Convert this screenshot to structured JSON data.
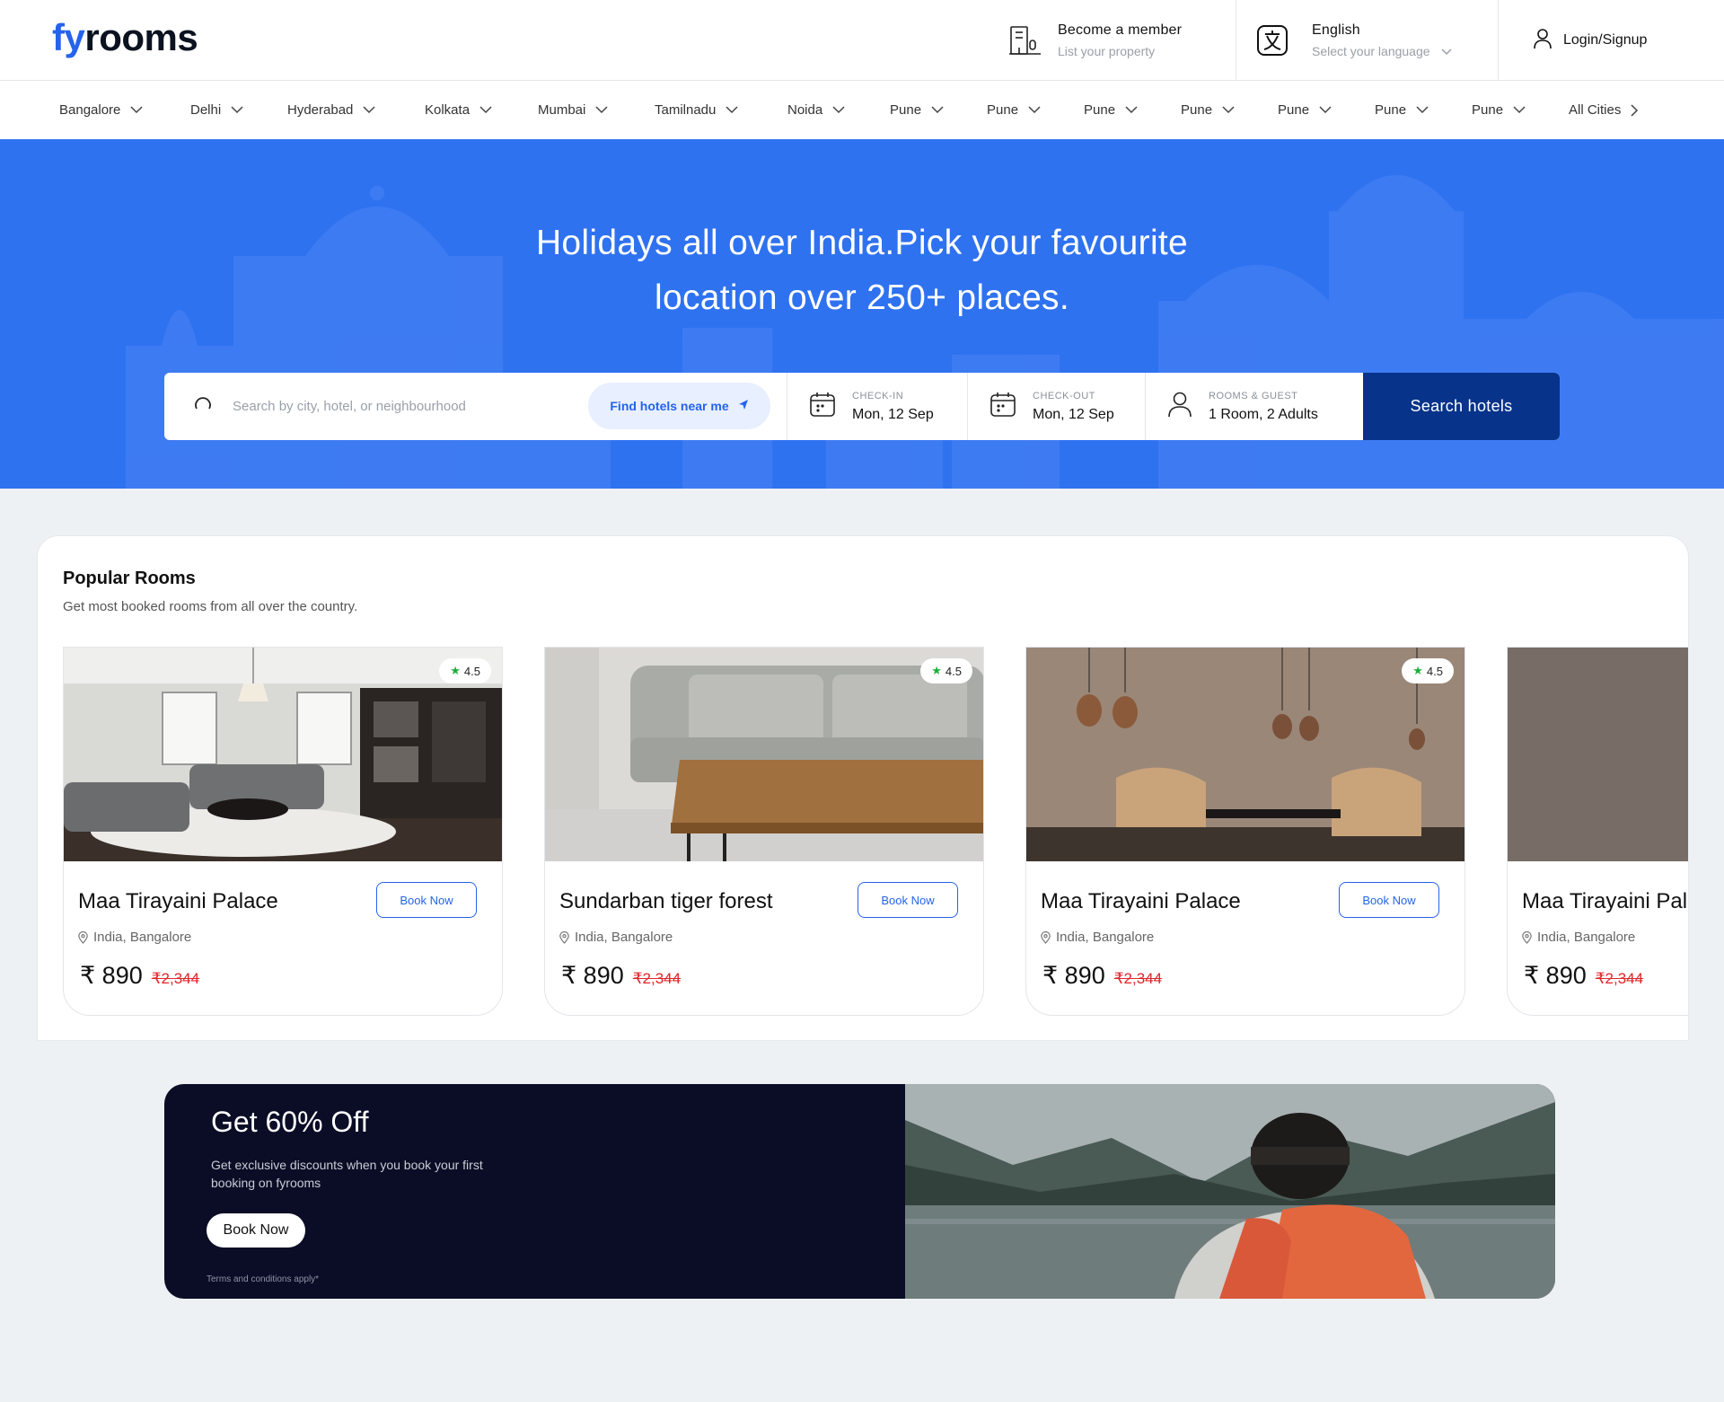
{
  "brand": {
    "part1": "fy",
    "part2": "rooms",
    "accent": "#2563eb"
  },
  "header": {
    "member_title": "Become a member",
    "member_sub": "List your property",
    "language_title": "English",
    "language_sub": "Select your language",
    "login": "Login/Signup"
  },
  "cities": [
    "Bangalore",
    "Delhi",
    "Hyderabad",
    "Kolkata",
    "Mumbai",
    "Tamilnadu",
    "Noida",
    "Pune",
    "Pune",
    "Pune",
    "Pune",
    "Pune",
    "Pune",
    "Pune",
    "All Cities"
  ],
  "hero": {
    "title_line1": "Holidays all over India.Pick your favourite",
    "title_line2": "location over 250+ places.",
    "color": "#2f72f0"
  },
  "search": {
    "placeholder": "Search by city, hotel, or neighbourhood",
    "near_me": "Find hotels near me",
    "checkin_label": "CHECK-IN",
    "checkin_value": "Mon, 12 Sep",
    "checkout_label": "CHECK-OUT",
    "checkout_value": "Mon, 12 Sep",
    "rooms_label": "ROOMS & GUEST",
    "rooms_value": "1 Room, 2 Adults",
    "button": "Search hotels",
    "button_color": "#07338a"
  },
  "popular": {
    "title": "Popular Rooms",
    "subtitle": "Get most booked rooms from all over the country.",
    "cards": [
      {
        "rating": "4.5",
        "name": "Maa Tirayaini Palace",
        "location": "India, Bangalore",
        "price": "₹ 890",
        "old_price": "₹2,344",
        "book": "Book Now"
      },
      {
        "rating": "4.5",
        "name": "Sundarban tiger forest",
        "location": "India, Bangalore",
        "price": "₹ 890",
        "old_price": "₹2,344",
        "book": "Book Now"
      },
      {
        "rating": "4.5",
        "name": "Maa Tirayaini Palace",
        "location": "India, Bangalore",
        "price": "₹ 890",
        "old_price": "₹2,344",
        "book": "Book Now"
      },
      {
        "rating": "",
        "name": "Maa Tirayaini Palace",
        "location": "India, Bangalore",
        "price": "₹ 890",
        "old_price": "₹2,344",
        "book": ""
      }
    ]
  },
  "promo": {
    "title": "Get 60% Off",
    "text": "Get exclusive discounts when you book your first booking on fyrooms",
    "button": "Book Now",
    "terms": "Terms and conditions apply*"
  },
  "icons": {
    "member": "building-icon",
    "language": "translate-icon",
    "login": "user-icon",
    "search": "search-icon",
    "near": "navigation-arrow-icon",
    "calendar": "calendar-icon",
    "guests": "user-icon",
    "location": "location-pin-icon",
    "rating": "star-icon",
    "chevron": "chevron-down-icon"
  }
}
